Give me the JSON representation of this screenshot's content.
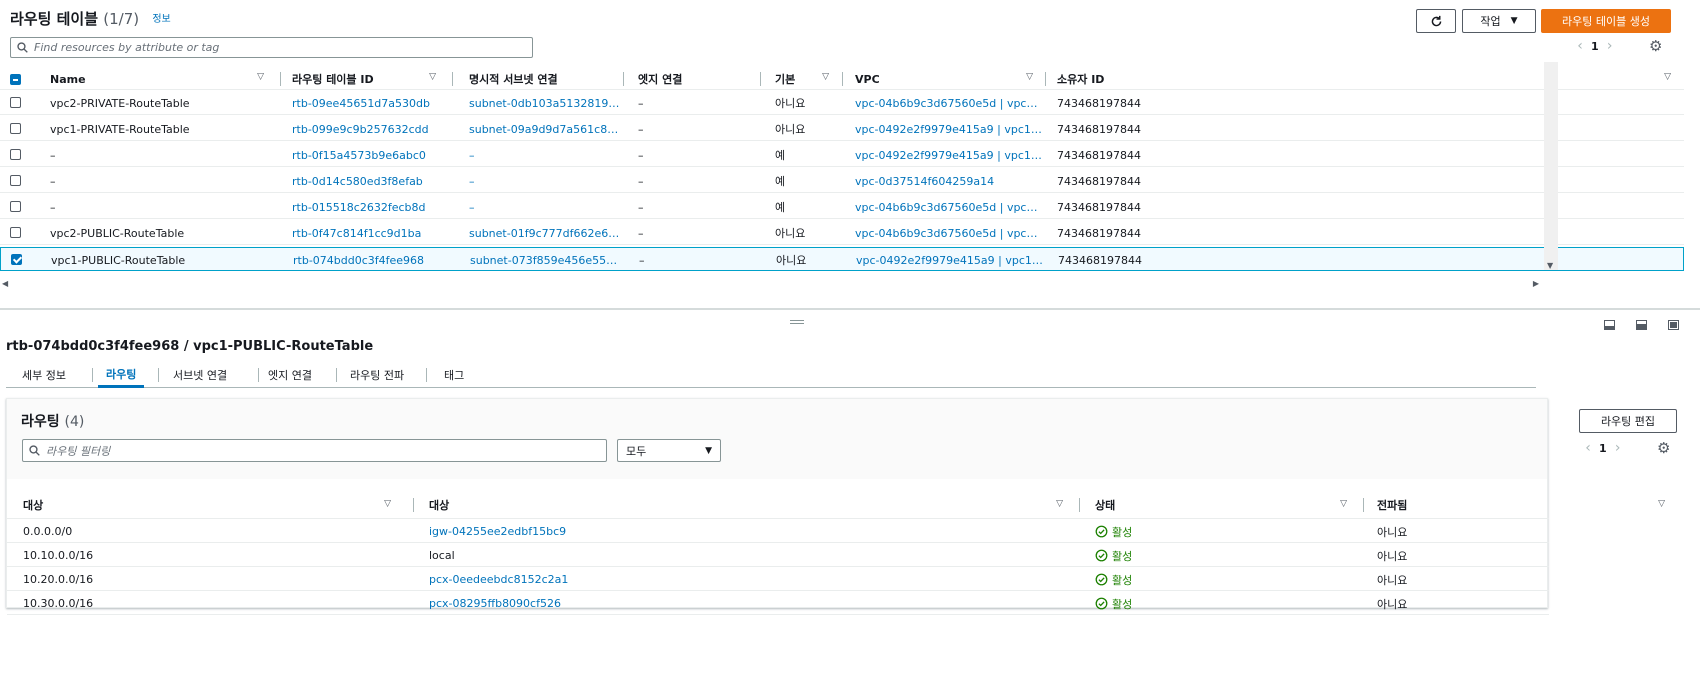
{
  "header": {
    "title": "라우팅 테이블",
    "count": "(1/7)",
    "info": "정보",
    "refresh_icon": "refresh-icon",
    "actions_label": "작업",
    "create_label": "라우팅 테이블 생성",
    "search_placeholder": "Find resources by attribute or tag",
    "page": "1"
  },
  "columns": [
    "Name",
    "라우팅 테이블 ID",
    "명시적 서브넷 연결",
    "엣지 연결",
    "기본",
    "VPC",
    "소유자 ID"
  ],
  "rows": [
    {
      "name": "vpc2-PRIVATE-RouteTable",
      "id": "rtb-09ee45651d7a530db",
      "subnet": "subnet-0db103a5132819…",
      "edge": "–",
      "main": "아니요",
      "vpc": "vpc-04b6b9c3d67560e5d | vpc…",
      "owner": "743468197844",
      "selected": false
    },
    {
      "name": "vpc1-PRIVATE-RouteTable",
      "id": "rtb-099e9c9b257632cdd",
      "subnet": "subnet-09a9d9d7a561c8…",
      "edge": "–",
      "main": "아니요",
      "vpc": "vpc-0492e2f9979e415a9 | vpc1…",
      "owner": "743468197844",
      "selected": false
    },
    {
      "name": "–",
      "id": "rtb-0f15a4573b9e6abc0",
      "subnet": "–",
      "edge": "–",
      "main": "예",
      "vpc": "vpc-0492e2f9979e415a9 | vpc1…",
      "owner": "743468197844",
      "selected": false
    },
    {
      "name": "–",
      "id": "rtb-0d14c580ed3f8efab",
      "subnet": "–",
      "edge": "–",
      "main": "예",
      "vpc": "vpc-0d37514f604259a14",
      "owner": "743468197844",
      "selected": false
    },
    {
      "name": "–",
      "id": "rtb-015518c2632fecb8d",
      "subnet": "–",
      "edge": "–",
      "main": "예",
      "vpc": "vpc-04b6b9c3d67560e5d | vpc…",
      "owner": "743468197844",
      "selected": false
    },
    {
      "name": "vpc2-PUBLIC-RouteTable",
      "id": "rtb-0f47c814f1cc9d1ba",
      "subnet": "subnet-01f9c777df662e6…",
      "edge": "–",
      "main": "아니요",
      "vpc": "vpc-04b6b9c3d67560e5d | vpc…",
      "owner": "743468197844",
      "selected": false
    },
    {
      "name": "vpc1-PUBLIC-RouteTable",
      "id": "rtb-074bdd0c3f4fee968",
      "subnet": "subnet-073f859e456e55…",
      "edge": "–",
      "main": "아니요",
      "vpc": "vpc-0492e2f9979e415a9 | vpc1…",
      "owner": "743468197844",
      "selected": true
    }
  ],
  "detail": {
    "title": "rtb-074bdd0c3f4fee968 / vpc1-PUBLIC-RouteTable",
    "tabs": [
      "세부 정보",
      "라우팅",
      "서브넷 연결",
      "엣지 연결",
      "라우팅 전파",
      "태그"
    ],
    "active_tab": "라우팅",
    "routes_title": "라우팅",
    "routes_count": "(4)",
    "edit_label": "라우팅 편집",
    "filter_placeholder": "라우팅 필터링",
    "filter_select": "모두",
    "page": "1",
    "route_columns": [
      "대상",
      "대상",
      "상태",
      "전파됨"
    ],
    "routes": [
      {
        "dest": "0.0.0.0/0",
        "target": "igw-04255ee2edbf15bc9",
        "status": "활성",
        "prop": "아니요",
        "target_link": true
      },
      {
        "dest": "10.10.0.0/16",
        "target": "local",
        "status": "활성",
        "prop": "아니요",
        "target_link": false
      },
      {
        "dest": "10.20.0.0/16",
        "target": "pcx-0eedeebdc8152c2a1",
        "status": "활성",
        "prop": "아니요",
        "target_link": true
      },
      {
        "dest": "10.30.0.0/16",
        "target": "pcx-08295ffb8090cf526",
        "status": "활성",
        "prop": "아니요",
        "target_link": true
      }
    ]
  },
  "colors": {
    "accent": "#0073bb",
    "primary": "#ec7211",
    "success": "#1d8102"
  }
}
